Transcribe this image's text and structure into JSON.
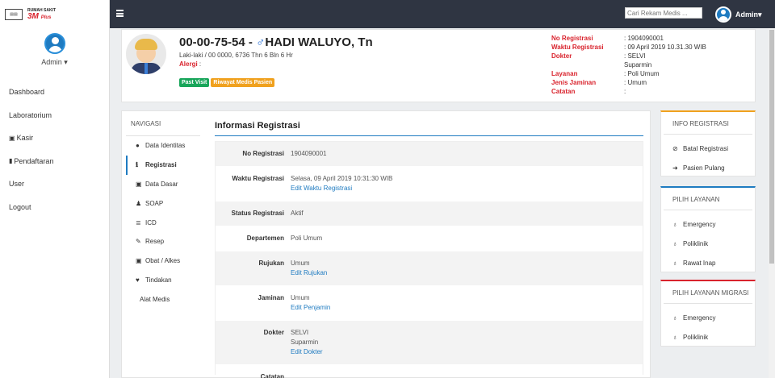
{
  "brand": {
    "line1": "RUMAH SAKIT",
    "line2": "3M",
    "line2_suffix": "Plus"
  },
  "sidebar": {
    "user_label": "Admin ▾",
    "items": [
      {
        "label": "Dashboard",
        "icon": ""
      },
      {
        "label": "Laboratorium",
        "icon": ""
      },
      {
        "label": "Kasir",
        "icon": "money-icon"
      },
      {
        "label": "Pendaftaran",
        "icon": "document-icon"
      },
      {
        "label": "User",
        "icon": ""
      },
      {
        "label": "Logout",
        "icon": ""
      }
    ]
  },
  "topbar": {
    "search_placeholder": "Cari Rekam Medis ...",
    "user_label": "Admin▾"
  },
  "patient": {
    "record_no": "00-00-75-54 - ",
    "sex_symbol": "♂",
    "name": "HADI WALUYO, Tn",
    "sub": "Laki-laki / 00 0000, 6736 Thn 6 Bln 6 Hr",
    "alergi_label": "Alergi",
    "alergi_value": " :",
    "badges": [
      "Past Visit",
      "Riwayat Medis Pasien"
    ],
    "reg_info": [
      {
        "key": "No Registrasi",
        "value": ": 1904090001"
      },
      {
        "key": "Waktu Registrasi",
        "value": ": 09 April 2019 10.31.30 WIB"
      },
      {
        "key": "Dokter",
        "value": ": SELVI"
      },
      {
        "key": "",
        "value": "  Suparmin"
      },
      {
        "key": "Layanan",
        "value": ": Poli Umum"
      },
      {
        "key": "Jenis Jaminan",
        "value": ": Umum"
      },
      {
        "key": "Catatan",
        "value": ":"
      }
    ],
    "colors": {
      "label": "#d9232d",
      "sex": "#1e6bd6"
    }
  },
  "navigation": {
    "title": "NAVIGASI",
    "items": [
      {
        "label": "Data Identitas",
        "icon": "user-icon"
      },
      {
        "label": "Registrasi",
        "icon": "info-icon",
        "active": true
      },
      {
        "label": "Data Dasar",
        "icon": "medkit-icon"
      },
      {
        "label": "SOAP",
        "icon": "users-icon"
      },
      {
        "label": "ICD",
        "icon": "list-icon"
      },
      {
        "label": "Resep",
        "icon": "pencil-icon"
      },
      {
        "label": "Obat / Alkes",
        "icon": "medkit-icon"
      },
      {
        "label": "Tindakan",
        "icon": "heartbeat-icon"
      },
      {
        "label": "Alat Medis",
        "icon": ""
      }
    ]
  },
  "info_registrasi": {
    "title": "Informasi Registrasi",
    "rows": [
      {
        "key": "No Registrasi",
        "lines": [
          "1904090001"
        ],
        "link": ""
      },
      {
        "key": "Waktu Registrasi",
        "lines": [
          "Selasa, 09 April 2019 10:31:30 WIB"
        ],
        "link": "Edit Waktu Registrasi"
      },
      {
        "key": "Status Registrasi",
        "lines": [
          "Aktif"
        ],
        "link": ""
      },
      {
        "key": "Departemen",
        "lines": [
          "Poli Umum"
        ],
        "link": ""
      },
      {
        "key": "Rujukan",
        "lines": [
          "Umum"
        ],
        "link": "Edit Rujukan"
      },
      {
        "key": "Jaminan",
        "lines": [
          "Umum"
        ],
        "link": "Edit Penjamin"
      },
      {
        "key": "Dokter",
        "lines": [
          "SELVI",
          "Suparmin"
        ],
        "link": "Edit Dokter"
      },
      {
        "key": "Catatan",
        "lines": [
          ""
        ],
        "link": ""
      }
    ],
    "link_color": "#1f7bc1"
  },
  "widgets": {
    "info": {
      "title": "INFO REGISTRASI",
      "items": [
        {
          "label": "Batal Registrasi",
          "icon": "ban-icon"
        },
        {
          "label": "Pasien Pulang",
          "icon": "sign-out-icon"
        }
      ]
    },
    "layanan": {
      "title": "PILIH LAYANAN",
      "items": [
        {
          "label": "Emergency",
          "icon": "stethoscope-icon"
        },
        {
          "label": "Poliklinik",
          "icon": "stethoscope-icon"
        },
        {
          "label": "Rawat Inap",
          "icon": "stethoscope-icon"
        }
      ]
    },
    "migrasi": {
      "title": "PILIH LAYANAN MIGRASI",
      "items": [
        {
          "label": "Emergency",
          "icon": "stethoscope-icon"
        },
        {
          "label": "Poliklinik",
          "icon": "stethoscope-icon"
        }
      ]
    }
  }
}
